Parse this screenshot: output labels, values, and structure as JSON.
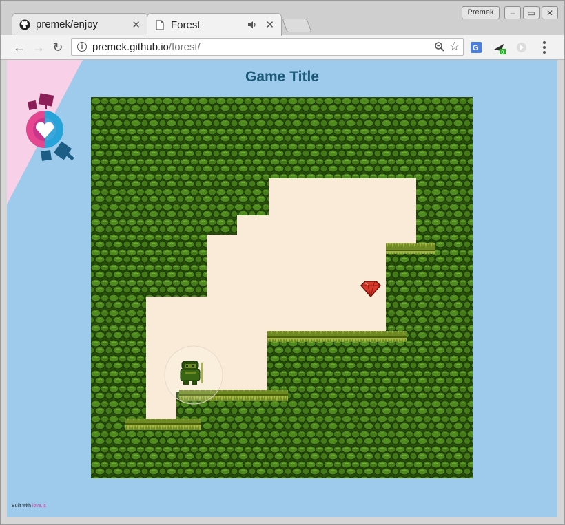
{
  "browser": {
    "tabs": [
      {
        "title": "premek/enjoy",
        "icon": "github-icon",
        "active": false
      },
      {
        "title": "Forest",
        "icon": "page-icon",
        "active": true,
        "audio": true
      }
    ],
    "profile_name": "Premek",
    "url": {
      "host": "premek.github.io",
      "path": "/forest/"
    },
    "extension_badge": "0"
  },
  "page": {
    "title": "Game Title",
    "footer": {
      "prefix": "Built with",
      "link": "love.js"
    }
  },
  "colors": {
    "page_bg": "#9ecbec",
    "ribbon": "#f8d0e8",
    "title": "#1d5a7a",
    "foliage_dark": "#2f5510",
    "foliage_light": "#4f8a1e",
    "sky": "#faebd8",
    "gem": "#d8372a",
    "lovejs": "#e0339a"
  },
  "icons": [
    "github-icon",
    "page-icon",
    "close-icon",
    "audio-icon",
    "back-icon",
    "forward-icon",
    "reload-icon",
    "info-icon",
    "zoom-icon",
    "star-icon",
    "translate-icon",
    "extension-icon",
    "cast-icon",
    "menu-icon",
    "heart-logo-icon",
    "gem-icon",
    "player-icon"
  ]
}
